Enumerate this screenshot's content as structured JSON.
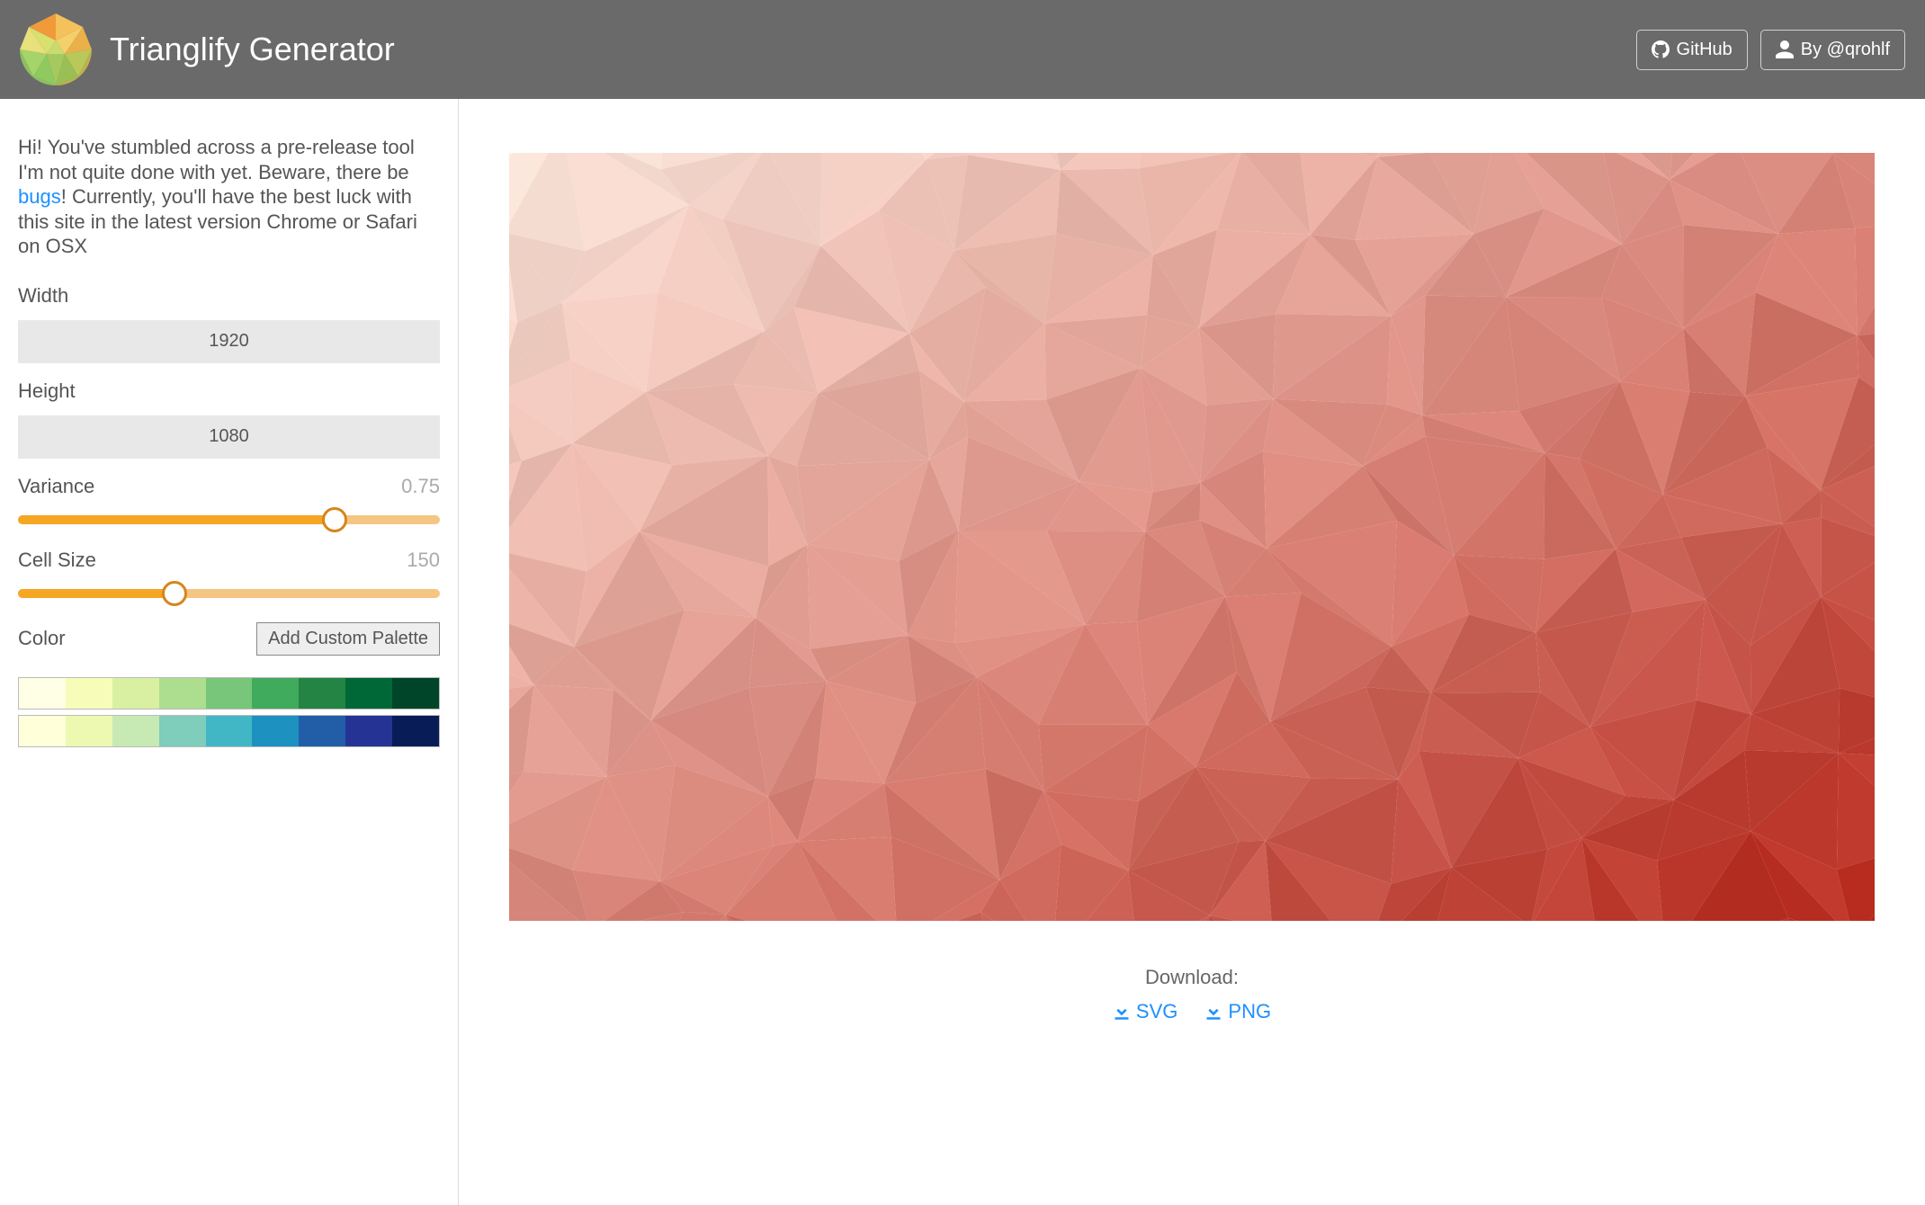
{
  "header": {
    "title": "Trianglify Generator",
    "github_label": "GitHub",
    "author_label": "By @qrohlf"
  },
  "intro": {
    "text_before": "Hi! You've stumbled across a pre-release tool I'm not quite done with yet. Beware, there be ",
    "bugs_link": "bugs",
    "text_after": "! Currently, you'll have the best luck with this site in the latest version Chrome or Safari on OSX"
  },
  "controls": {
    "width_label": "Width",
    "width_value": "1920",
    "height_label": "Height",
    "height_value": "1080",
    "variance_label": "Variance",
    "variance_value": "0.75",
    "variance_percent": 75,
    "cellsize_label": "Cell Size",
    "cellsize_value": "150",
    "cellsize_percent": 37,
    "color_label": "Color",
    "add_palette_label": "Add Custom Palette"
  },
  "palettes": [
    [
      "#ffffe5",
      "#f7fcb9",
      "#d9f0a3",
      "#addd8e",
      "#78c679",
      "#41ab5d",
      "#238443",
      "#006837",
      "#004529"
    ],
    [
      "#ffffd9",
      "#edf8b1",
      "#c7e9b4",
      "#7fcdbb",
      "#41b6c4",
      "#1d91c0",
      "#225ea8",
      "#253494",
      "#081d58"
    ]
  ],
  "download": {
    "label": "Download:",
    "svg_label": "SVG",
    "png_label": "PNG"
  },
  "logo_colors": [
    "#f09a3a",
    "#f5c15a",
    "#e8e07a",
    "#b8d96a",
    "#8fc95f",
    "#eab04a"
  ]
}
